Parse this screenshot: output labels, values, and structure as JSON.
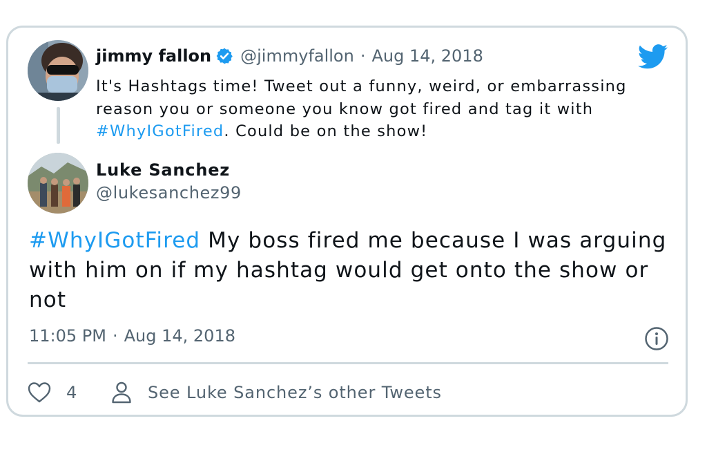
{
  "parent_tweet": {
    "name": "jimmy fallon",
    "handle": "@jimmyfallon",
    "separator": "·",
    "date": "Aug 14, 2018",
    "text_before": "It's Hashtags time! Tweet out a funny, weird, or embarrassing reason you or someone you know got fired and tag it with ",
    "hashtag": "#WhyIGotFired",
    "text_after": ". Could be on the show!",
    "verified": true
  },
  "reply_tweet": {
    "name": "Luke Sanchez",
    "handle": "@lukesanchez99",
    "hashtag": "#WhyIGotFired",
    "text_after": " My boss fired me because I was arguing with him on if my hashtag would get onto the show or not",
    "time": "11:05 PM",
    "separator": "·",
    "date": "Aug 14, 2018"
  },
  "actions": {
    "like_count": "4",
    "other_tweets_label": "See Luke Sanchez’s other Tweets"
  },
  "icons": {
    "brand": "twitter-bird-icon",
    "verified": "verified-badge-icon",
    "info": "info-icon",
    "like": "heart-icon",
    "profile": "person-icon"
  },
  "colors": {
    "accent": "#1d9bf0",
    "text": "#0f1419",
    "muted": "#536471",
    "border": "#cfd9de"
  }
}
